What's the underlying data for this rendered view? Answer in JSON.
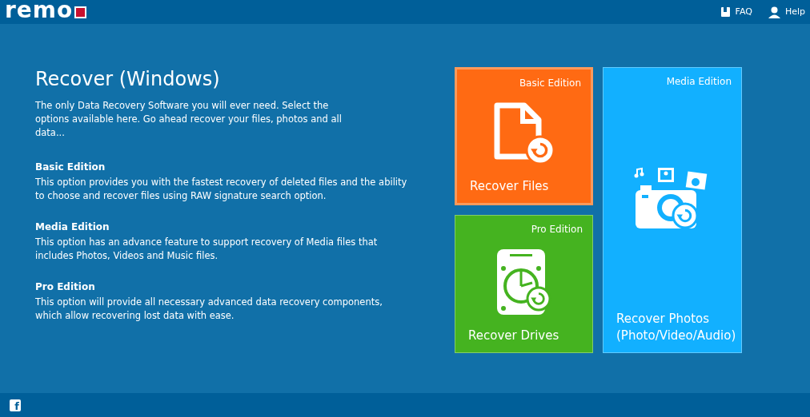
{
  "header": {
    "logo": "remo",
    "links": [
      {
        "kind": "faq",
        "label": "FAQ"
      },
      {
        "kind": "help",
        "label": "Help"
      }
    ]
  },
  "intro": {
    "title": "Recover (Windows)",
    "text": "The only Data Recovery Software you will ever need. Select the options available here. Go ahead recover your files, photos and all data..."
  },
  "editions": [
    {
      "name": "Basic Edition",
      "text": "This option provides you with the fastest recovery of deleted files and the ability to choose and recover files using RAW signature search option."
    },
    {
      "name": "Media Edition",
      "text": "This option has an advance feature to support recovery of Media files that includes Photos, Videos and Music files."
    },
    {
      "name": "Pro Edition",
      "text": "This option will provide all necessary advanced data recovery components, which allow recovering lost data with ease."
    }
  ],
  "tiles": [
    {
      "kind": "files",
      "edition": "Basic Edition",
      "label": "Recover Files",
      "selected": true
    },
    {
      "kind": "drives",
      "edition": "Pro Edition",
      "label": "Recover Drives",
      "selected": false
    },
    {
      "kind": "photos",
      "edition": "Media Edition",
      "label": "Recover Photos (Photo/Video/Audio)",
      "selected": false
    }
  ],
  "footer": {
    "social": "f"
  }
}
